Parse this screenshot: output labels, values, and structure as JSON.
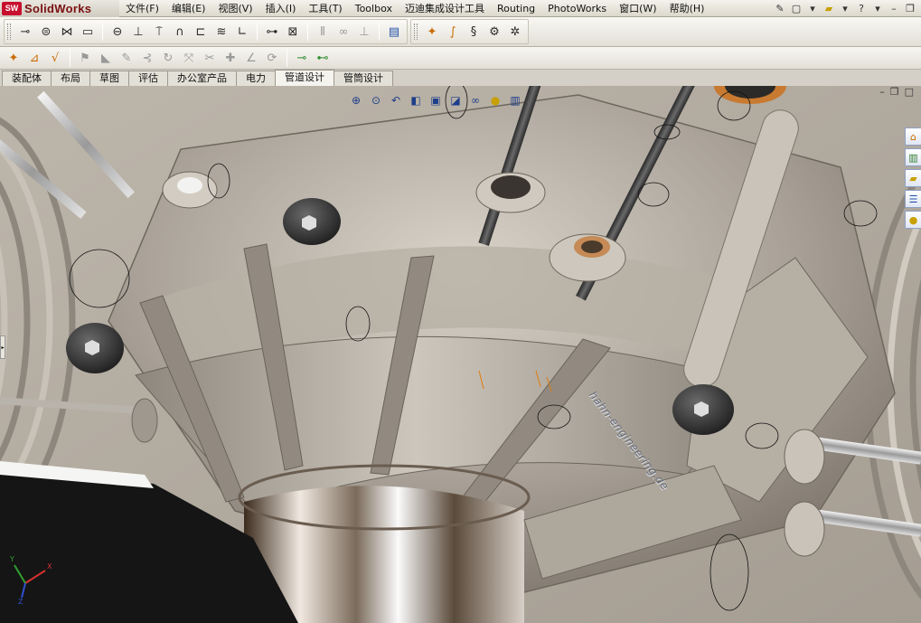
{
  "app": {
    "brand_prefix": "SW",
    "brand_name": "SolidWorks"
  },
  "menu": {
    "items": [
      "文件(F)",
      "编辑(E)",
      "视图(V)",
      "插入(I)",
      "工具(T)",
      "Toolbox",
      "迈迪集成设计工具",
      "Routing",
      "PhotoWorks",
      "窗口(W)",
      "帮助(H)"
    ]
  },
  "command_tabs": {
    "items": [
      "装配体",
      "布局",
      "草图",
      "评估",
      "办公室产品",
      "电力",
      "管道设计",
      "管筒设计"
    ],
    "active": "管道设计"
  },
  "model": {
    "watermark": "hahn-engineering.de"
  },
  "triad": {
    "x": "X",
    "y": "Y",
    "z": "Z"
  },
  "colors": {
    "brand_red": "#c8102e",
    "casting": "#9d958b",
    "axis_x": "#d83030",
    "axis_y": "#30a030",
    "axis_z": "#3050d0"
  }
}
